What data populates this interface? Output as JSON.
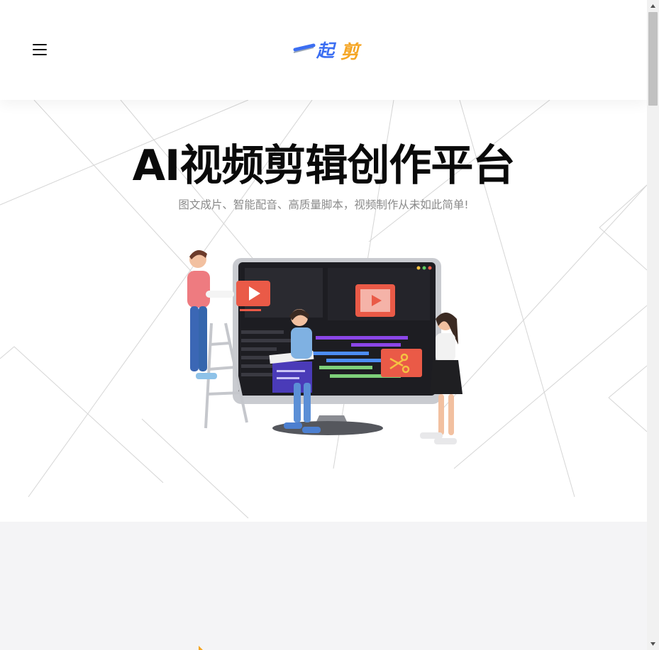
{
  "header": {
    "logo": {
      "text": "一起剪",
      "colors": {
        "blue": "#3b6ef2",
        "orange": "#f5a523"
      }
    },
    "menu_icon": "hamburger-menu-icon"
  },
  "hero": {
    "title": "AI视频剪辑创作平台",
    "subtitle": "图文成片、智能配音、高质量脚本，视频制作从未如此简单!",
    "illustration": "video-editing-illustration"
  },
  "colors": {
    "accent_red": "#ea5a47",
    "monitor_dark": "#1d1d22",
    "section_gray": "#f4f4f6"
  }
}
